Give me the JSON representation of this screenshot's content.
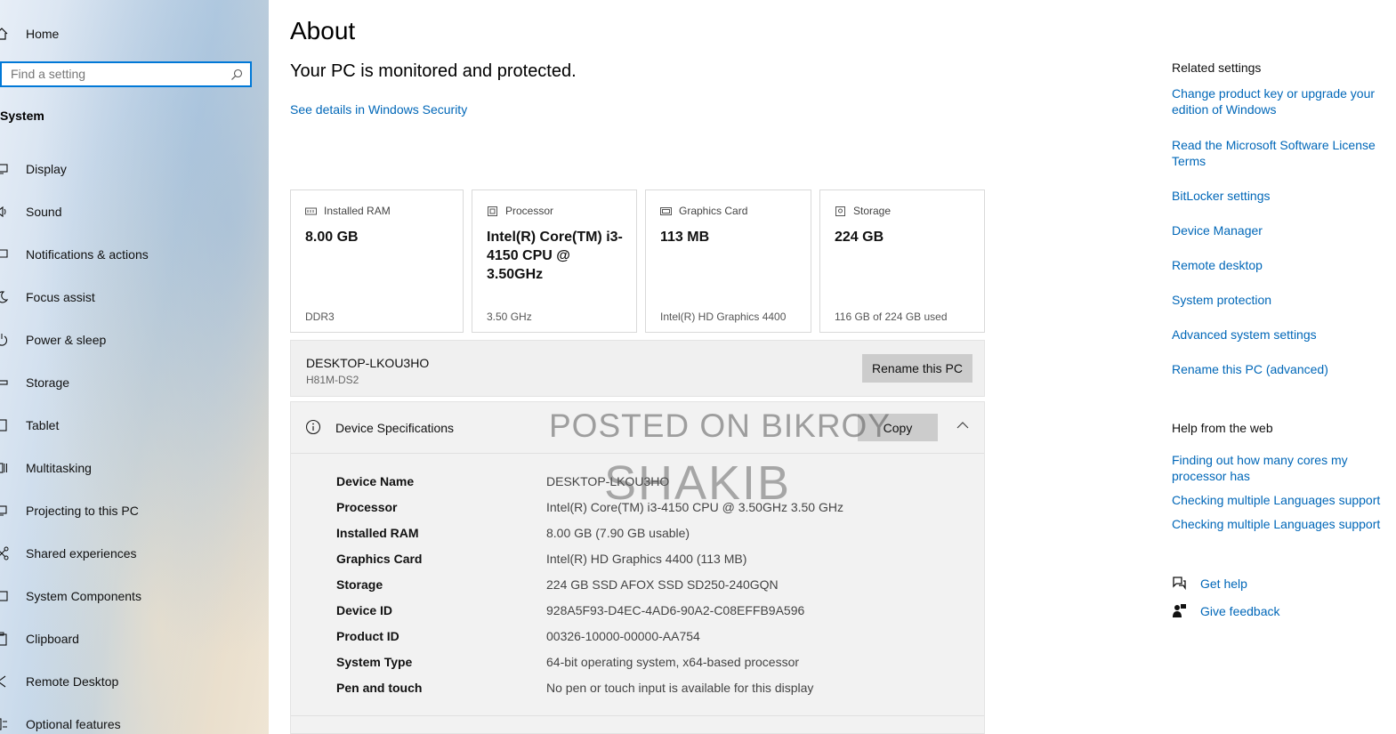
{
  "sidebar": {
    "home_label": "Home",
    "search_placeholder": "Find a setting",
    "section_title": "System",
    "items": [
      {
        "label": "Display",
        "icon": "monitor-icon"
      },
      {
        "label": "Sound",
        "icon": "speaker-icon"
      },
      {
        "label": "Notifications & actions",
        "icon": "message-icon"
      },
      {
        "label": "Focus assist",
        "icon": "moon-icon"
      },
      {
        "label": "Power & sleep",
        "icon": "power-icon"
      },
      {
        "label": "Storage",
        "icon": "drive-icon"
      },
      {
        "label": "Tablet",
        "icon": "tablet-icon"
      },
      {
        "label": "Multitasking",
        "icon": "multitasking-icon"
      },
      {
        "label": "Projecting to this PC",
        "icon": "projector-icon"
      },
      {
        "label": "Shared experiences",
        "icon": "share-icon"
      },
      {
        "label": "System Components",
        "icon": "components-icon"
      },
      {
        "label": "Clipboard",
        "icon": "clipboard-icon"
      },
      {
        "label": "Remote Desktop",
        "icon": "remote-icon"
      },
      {
        "label": "Optional features",
        "icon": "features-icon"
      }
    ]
  },
  "main": {
    "title": "About",
    "protected_text": "Your PC is monitored and protected.",
    "security_link": "See details in Windows Security",
    "cards": [
      {
        "header": "Installed RAM",
        "value": "8.00 GB",
        "footer": "DDR3",
        "icon": "ram-icon"
      },
      {
        "header": "Processor",
        "value": "Intel(R) Core(TM) i3-4150 CPU @ 3.50GHz",
        "footer": "3.50 GHz",
        "icon": "processor-icon"
      },
      {
        "header": "Graphics Card",
        "value": "113 MB",
        "footer": "Intel(R) HD Graphics 4400",
        "icon": "graphics-card-icon"
      },
      {
        "header": "Storage",
        "value": "224 GB",
        "footer": "116 GB of 224 GB used",
        "icon": "storage-icon"
      }
    ],
    "pc_name": "DESKTOP-LKOU3HO",
    "pc_model": "H81M-DS2",
    "rename_button": "Rename this PC",
    "specs": {
      "title": "Device Specifications",
      "copy_button": "Copy",
      "rows": [
        {
          "key": "Device Name",
          "value": "DESKTOP-LKOU3HO"
        },
        {
          "key": "Processor",
          "value": "Intel(R) Core(TM) i3-4150 CPU @ 3.50GHz   3.50 GHz"
        },
        {
          "key": "Installed RAM",
          "value": "8.00 GB (7.90 GB usable)"
        },
        {
          "key": "Graphics Card",
          "value": "Intel(R) HD Graphics 4400 (113 MB)"
        },
        {
          "key": "Storage",
          "value": "224 GB SSD AFOX SSD SD250-240GQN"
        },
        {
          "key": "Device ID",
          "value": "928A5F93-D4EC-4AD6-90A2-C08EFFB9A596"
        },
        {
          "key": "Product ID",
          "value": "00326-10000-00000-AA754"
        },
        {
          "key": "System Type",
          "value": "64-bit operating system, x64-based processor"
        },
        {
          "key": "Pen and touch",
          "value": "No pen or touch input is available for this display"
        }
      ]
    },
    "watermark_line1": "POSTED ON BIKROY",
    "watermark_line2": "SHAKIB"
  },
  "right": {
    "related_title": "Related settings",
    "related_links": [
      "Change product key or upgrade your edition of Windows",
      "Read the Microsoft Software License Terms",
      "BitLocker settings",
      "Device Manager",
      "Remote desktop",
      "System protection",
      "Advanced system settings",
      "Rename this PC (advanced)"
    ],
    "help_title": "Help from the web",
    "help_links": [
      "Finding out how many cores my processor has",
      "Checking multiple Languages support",
      "Checking multiple Languages support"
    ],
    "get_help": "Get help",
    "give_feedback": "Give feedback"
  },
  "colors": {
    "accent": "#0078d7",
    "link": "#0067b8",
    "button": "#cccccc"
  }
}
